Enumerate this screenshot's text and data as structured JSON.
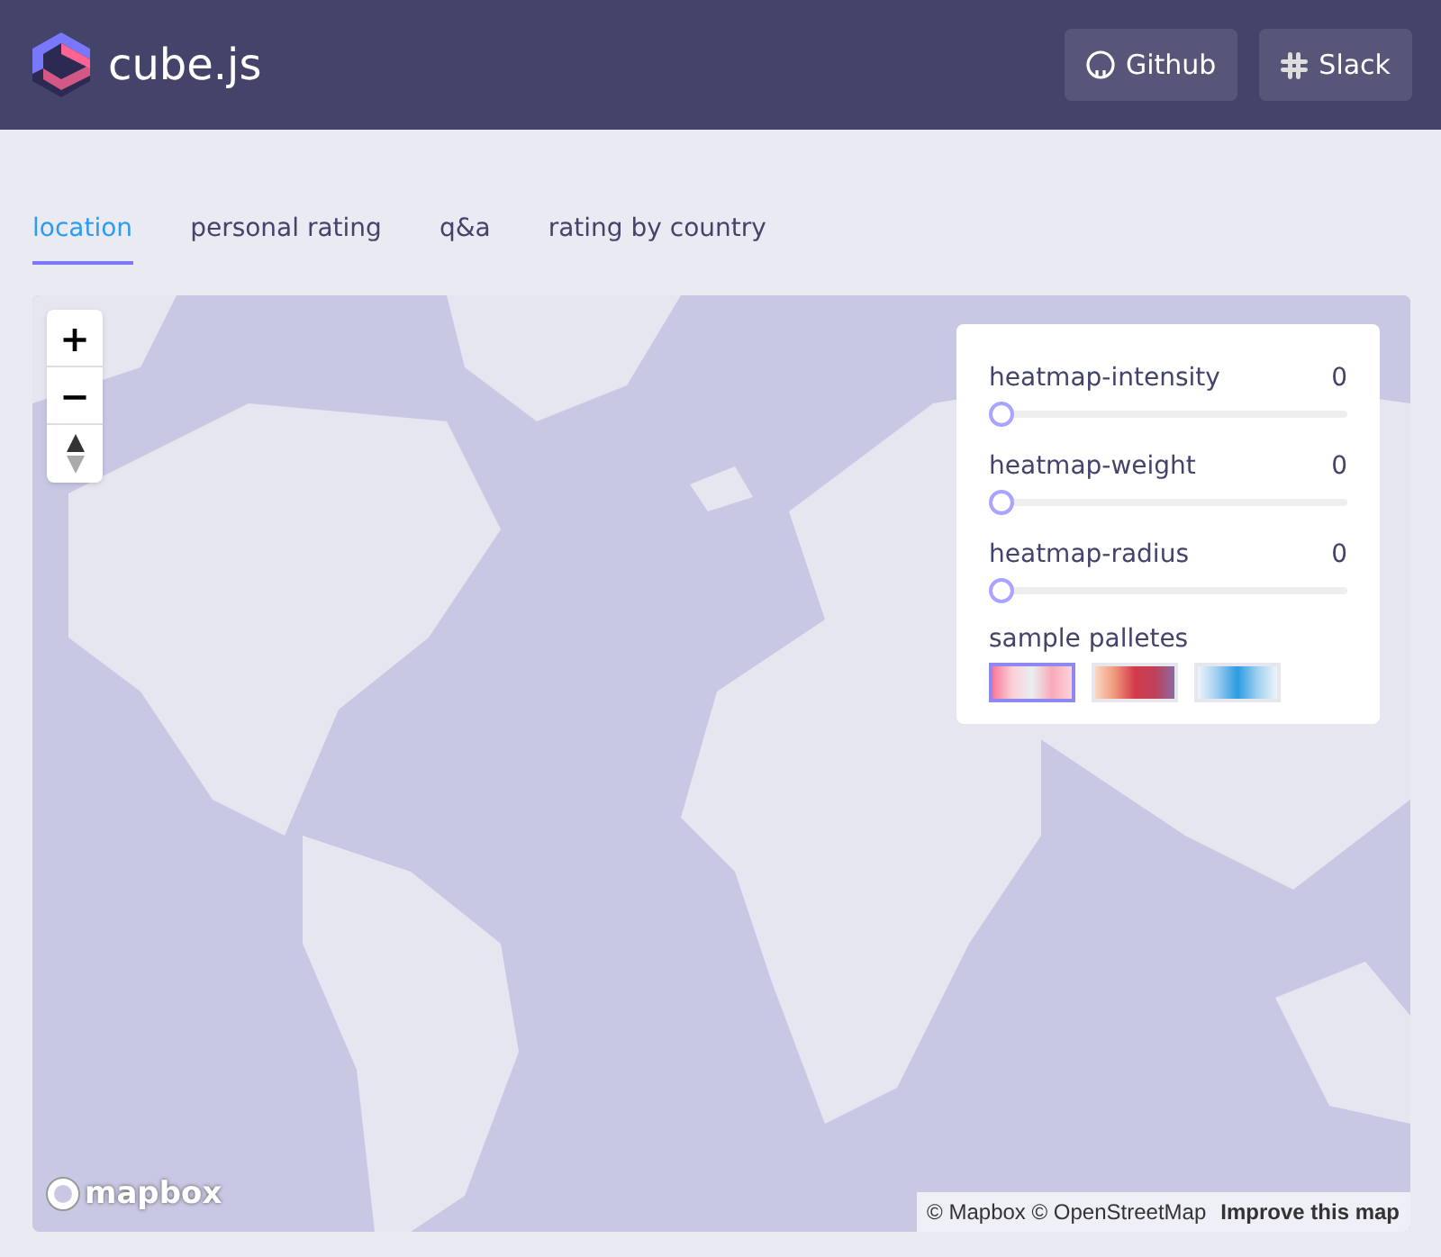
{
  "header": {
    "logo_text": "cube.js",
    "buttons": [
      {
        "kind": "github",
        "label": "Github"
      },
      {
        "kind": "slack",
        "label": "Slack"
      }
    ]
  },
  "tabs": [
    {
      "label": "location",
      "selected": true
    },
    {
      "label": "personal rating",
      "selected": false
    },
    {
      "label": "q&a",
      "selected": false
    },
    {
      "label": "rating by country",
      "selected": false
    }
  ],
  "map": {
    "controls": {
      "zoom_in": "+",
      "zoom_out": "−"
    },
    "panel": {
      "sliders": [
        {
          "name": "heatmap-intensity",
          "reading": "0",
          "level": 0
        },
        {
          "name": "heatmap-weight",
          "reading": "0",
          "level": 0
        },
        {
          "name": "heatmap-radius",
          "reading": "0",
          "level": 0
        }
      ],
      "palettes_label": "sample palletes",
      "palettes": [
        {
          "selected": true
        },
        {
          "selected": false
        },
        {
          "selected": false
        }
      ]
    },
    "logo_text": "mapbox",
    "attribution": "© Mapbox © OpenStreetMap",
    "improve_link": "Improve this map"
  }
}
